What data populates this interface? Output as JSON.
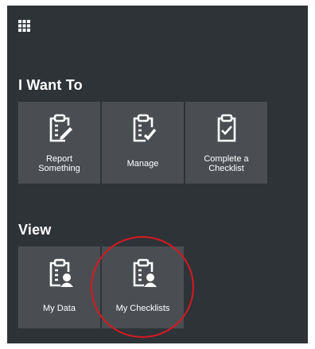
{
  "menu": {
    "grid_icon": "grid-icon"
  },
  "sections": {
    "i_want_to": {
      "title": "I Want To",
      "tiles": [
        {
          "label_line1": "Report",
          "label_line2": "Something",
          "icon": "clipboard-pencil-icon"
        },
        {
          "label_line1": "Manage",
          "label_line2": "",
          "icon": "clipboard-check-icon"
        },
        {
          "label_line1": "Complete a",
          "label_line2": "Checklist",
          "icon": "checklist-icon"
        }
      ]
    },
    "view": {
      "title": "View",
      "tiles": [
        {
          "label": "My Data",
          "icon": "clipboard-user-icon"
        },
        {
          "label": "My Checklists",
          "icon": "clipboard-user-icon"
        }
      ]
    }
  },
  "colors": {
    "panel_bg": "#2e3338",
    "tile_bg": "#4a4e53",
    "annotation": "#d71920"
  }
}
